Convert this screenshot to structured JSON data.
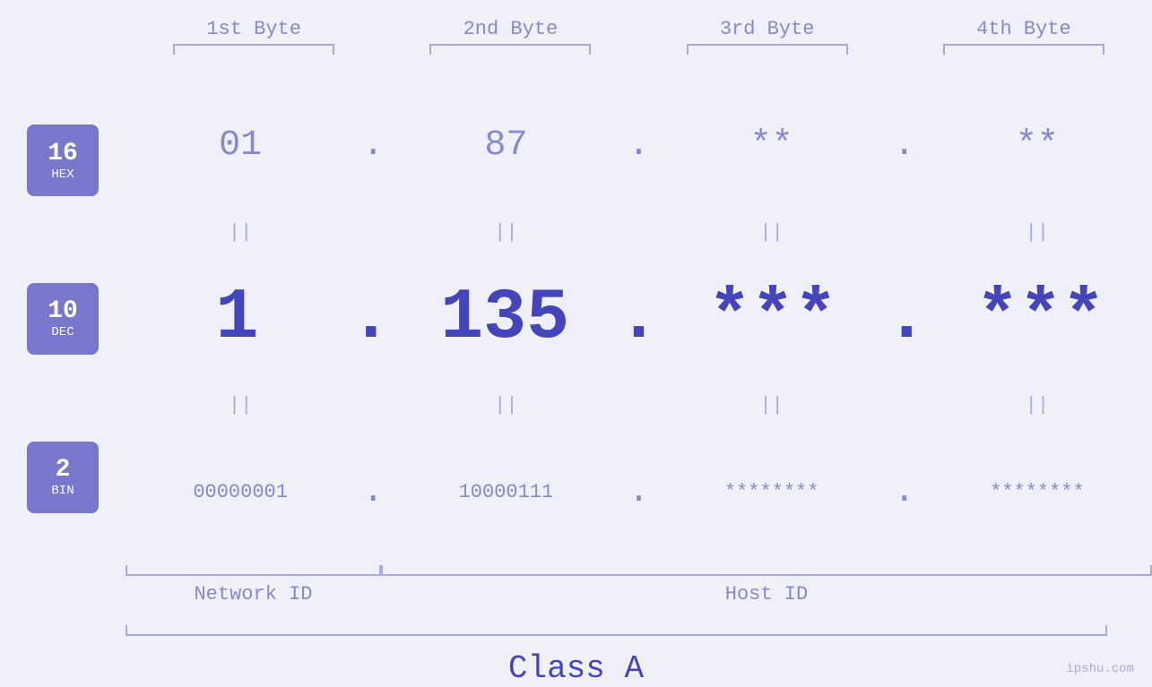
{
  "header": {
    "byte1": "1st Byte",
    "byte2": "2nd Byte",
    "byte3": "3rd Byte",
    "byte4": "4th Byte"
  },
  "badges": {
    "hex": {
      "num": "16",
      "label": "HEX"
    },
    "dec": {
      "num": "10",
      "label": "DEC"
    },
    "bin": {
      "num": "2",
      "label": "BIN"
    }
  },
  "rows": {
    "hex": {
      "b1": "01",
      "b2": "87",
      "b3": "**",
      "b4": "**",
      "sep": "."
    },
    "dec": {
      "b1": "1",
      "b2": "135.",
      "b3": "***.",
      "b4": "***",
      "sep": "."
    },
    "bin": {
      "b1": "00000001",
      "b2": "10000111",
      "b3": "********",
      "b4": "********",
      "sep": "."
    }
  },
  "equals": "||",
  "labels": {
    "network_id": "Network ID",
    "host_id": "Host ID",
    "class": "Class A"
  },
  "watermark": "ipshu.com"
}
